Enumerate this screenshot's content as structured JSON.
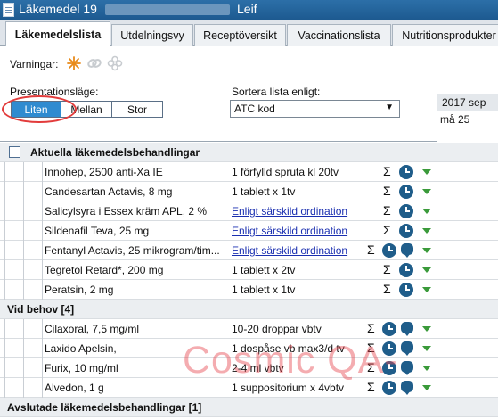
{
  "window": {
    "title_prefix": "Läkemedel 19",
    "title_suffix": "Leif"
  },
  "tabs": [
    "Läkemedelslista",
    "Utdelningsvy",
    "Receptöversikt",
    "Vaccinationslista",
    "Nutritionsprodukter"
  ],
  "popup": {
    "warnings_label": "Varningar:",
    "presentation_label": "Presentationsläge:",
    "presentation_options": [
      "Liten",
      "Mellan",
      "Stor"
    ],
    "presentation_selected": "Liten",
    "sort_label": "Sortera lista enligt:",
    "sort_value": "ATC kod"
  },
  "date_header": "2017 sep",
  "date_cell": "må 25",
  "sections": [
    {
      "title": "Aktuella läkemedelsbehandlingar",
      "items": [
        {
          "name": "Innohep, 2500 anti-Xa IE",
          "dose": "1 förfylld spruta kl 20tv",
          "link": false
        },
        {
          "name": "Candesartan Actavis, 8 mg",
          "dose": "1 tablett x 1tv",
          "link": false
        },
        {
          "name": "Salicylsyra i Essex kräm APL, 2 %",
          "dose": "Enligt särskild ordination",
          "link": true
        },
        {
          "name": "Sildenafil Teva, 25 mg",
          "dose": "Enligt särskild ordination",
          "link": true
        },
        {
          "name": "Fentanyl Actavis, 25 mikrogram/tim...",
          "dose": "Enligt särskild ordination",
          "link": true
        },
        {
          "name": "Tegretol Retard*, 200 mg",
          "dose": "1 tablett x 2tv",
          "link": false
        },
        {
          "name": "Peratsin, 2 mg",
          "dose": "1 tablett x 1tv",
          "link": false
        }
      ]
    },
    {
      "title": "Vid behov [4]",
      "items": [
        {
          "name": "Cilaxoral, 7,5 mg/ml",
          "dose": "10-20 droppar  vbtv",
          "link": false
        },
        {
          "name": "Laxido Apelsin,",
          "dose": "1 dospåse  vb max3/d tv",
          "link": false
        },
        {
          "name": "Furix, 10 mg/ml",
          "dose": "2-4 ml  vbtv",
          "link": false
        },
        {
          "name": "Alvedon, 1 g",
          "dose": "1 suppositorium x 4vbtv",
          "link": false
        }
      ]
    },
    {
      "title": "Avslutade läkemedelsbehandlingar [1]",
      "items": []
    }
  ],
  "icons": {
    "sum": "Σ",
    "accent_clock": "#1f5d8a",
    "accent_expand": "#3a9a3a"
  },
  "watermark": "Cosmic QA-"
}
